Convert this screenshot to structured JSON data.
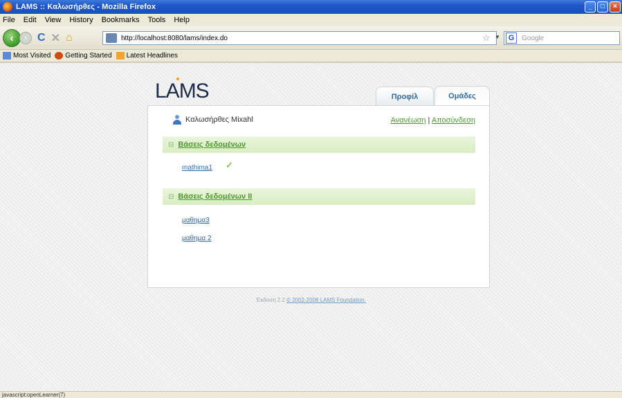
{
  "window": {
    "title": "LAMS :: Καλωσήρθες - Mozilla Firefox",
    "buttons": {
      "minimize": "_",
      "maximize": "□",
      "close": "×"
    }
  },
  "menu": [
    "File",
    "Edit",
    "View",
    "History",
    "Bookmarks",
    "Tools",
    "Help"
  ],
  "nav": {
    "url": "http://localhost:8080/lams/index.do",
    "search_placeholder": "Google"
  },
  "bookmarks": [
    "Most Visited",
    "Getting Started",
    "Latest Headlines"
  ],
  "page": {
    "logo": "LAMS",
    "tabs": [
      "Προφίλ",
      "Ομάδες"
    ],
    "user_name": "Καλωσήρθες Mixahl",
    "refresh_link": "Ανανέωση",
    "separator": "|",
    "logout_link": "Αποσύνδεση",
    "groups": [
      {
        "title": "Βάσεις δεδομένων",
        "courses": [
          "mathima1"
        ]
      },
      {
        "title": "Βάσεις δεδομένων II",
        "courses": [
          "μαθημα3",
          "μαθημα 2"
        ]
      }
    ],
    "footer_version": "Έκδοση 2.2",
    "footer_link": "© 2002-2008 LAMS Foundation."
  },
  "status": "javascript:openLearner(7)"
}
